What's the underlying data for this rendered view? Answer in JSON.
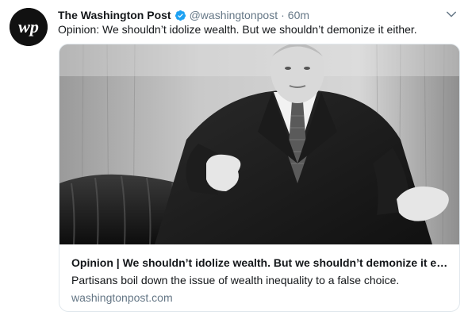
{
  "tweet": {
    "author": {
      "display_name": "The Washington Post",
      "handle": "@washingtonpost",
      "avatar_icon": "washington-post-logo",
      "verified": true
    },
    "separator": "·",
    "time_ago": "60m",
    "text": "Opinion: We shouldn’t idolize wealth. But we shouldn’t demonize it either.",
    "menu_icon": "chevron-down-icon"
  },
  "link_card": {
    "title": "Opinion | We shouldn’t idolize wealth. But we shouldn’t demonize it e…",
    "description": "Partisans boil down the issue of wealth inequality to a false choice.",
    "domain": "washingtonpost.com",
    "image": "black-and-white photo of a man in a suit gesturing with both hands"
  },
  "colors": {
    "text_primary": "#14171a",
    "text_secondary": "#657786",
    "verified_blue": "#1da1f2",
    "card_border": "#e1e8ed"
  }
}
